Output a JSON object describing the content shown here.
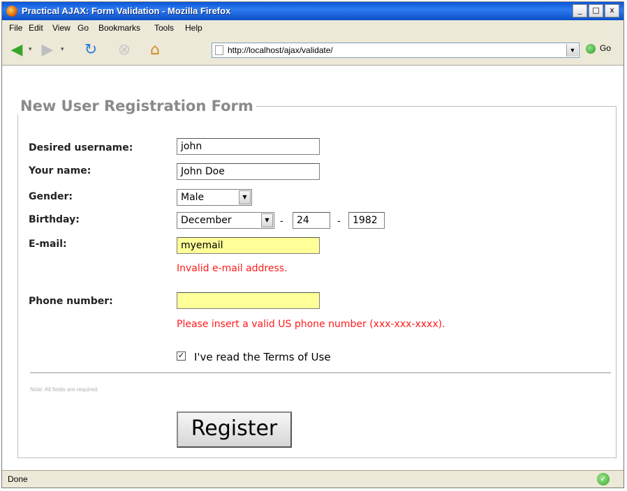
{
  "window": {
    "title": "Practical AJAX: Form Validation - Mozilla Firefox",
    "buttons": [
      "_",
      "□",
      "x"
    ]
  },
  "menu": [
    "File",
    "Edit",
    "View",
    "Go",
    "Bookmarks",
    "Tools",
    "Help"
  ],
  "toolbar": {
    "url": "http://localhost/ajax/validate/",
    "go_label": "Go",
    "icons": [
      "back-icon",
      "forward-icon",
      "reload-icon",
      "stop-icon",
      "home-icon",
      "page-icon",
      "go-icon"
    ]
  },
  "form": {
    "legend": "New User Registration Form",
    "username": {
      "label": "Desired username:",
      "value": "john"
    },
    "name": {
      "label": "Your name:",
      "value": "John Doe"
    },
    "gender": {
      "label": "Gender:",
      "value": "Male"
    },
    "birthday": {
      "label": "Birthday:",
      "month": "December",
      "day": "24",
      "year": "1982",
      "sep": "-"
    },
    "email": {
      "label": "E-mail:",
      "value": "myemail",
      "error": "Invalid e-mail address."
    },
    "phone": {
      "label": "Phone number:",
      "value": "",
      "error": "Please insert a valid US phone number (xxx-xxx-xxxx)."
    },
    "terms": {
      "label": "I've read the Terms of Use",
      "checked": true
    },
    "note": "Note: All fields are required.",
    "submit": "Register"
  },
  "statusbar": {
    "text": "Done"
  },
  "colors": {
    "error": "#ff1a1a",
    "invalid_field": "#ffff99",
    "legend": "#8a8a8a"
  }
}
